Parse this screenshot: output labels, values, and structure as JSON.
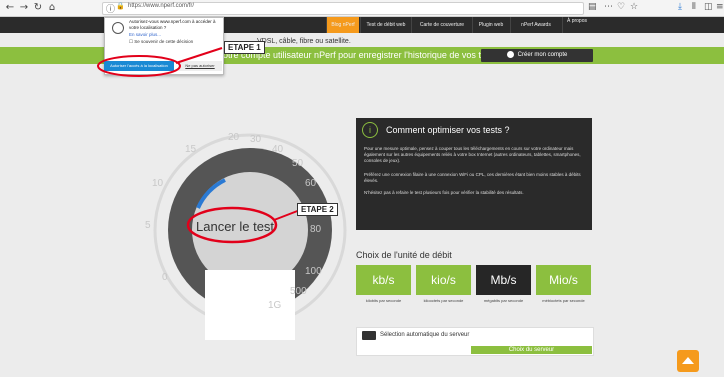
{
  "browser": {
    "url": "https://www.nperf.com/fr/",
    "icons": [
      "back-icon",
      "forward-icon",
      "reload-icon",
      "home-icon"
    ]
  },
  "nav": {
    "items": [
      "Blog nPerf",
      "Test de débit web",
      "Carte de couverture",
      "Plugin web",
      "nPerf Awards",
      "À propos"
    ]
  },
  "info_line": "VDSL, câble, fibre ou satellite.",
  "banner": {
    "text": "NOUVEAU ! Créez votre compte utilisateur nPerf pour enregistrer l'historique de vos tests",
    "button": "Créer mon compte"
  },
  "gauge": {
    "button": "Lancer le test",
    "ticks": [
      "0",
      "5",
      "10",
      "15",
      "20",
      "30",
      "40",
      "50",
      "60",
      "80",
      "100",
      "500",
      "1G"
    ]
  },
  "advice": {
    "title": "Comment optimiser vos tests ?",
    "p1": "Pour une mesure optimale, pensez à couper tous les téléchargements en cours sur votre ordinateur mais également sur les autres équipements reliés à votre box Internet (autres ordinateurs, tablettes, smartphones, consoles de jeux).",
    "p2": "Préférez une connexion filaire à une connexion WiFi ou CPL, ces dernières étant bien moins stables à débits élevés.",
    "p3": "N'hésitez pas à refaire le test plusieurs fois pour vérifier la stabilité des résultats."
  },
  "units": {
    "title": "Choix de l'unité de débit",
    "items": [
      {
        "label": "kb/s",
        "sub": "kilobits par seconde"
      },
      {
        "label": "kio/s",
        "sub": "kilooctets par seconde"
      },
      {
        "label": "Mb/s",
        "sub": "mégabits par seconde"
      },
      {
        "label": "Mio/s",
        "sub": "mébioctets par seconde"
      }
    ]
  },
  "server": {
    "label": "Sélection automatique du serveur",
    "button": "Choix du serveur"
  },
  "popup": {
    "text": "Autorisez-vous www.nperf.com à accéder à votre localisation ?",
    "more": "En savoir plus...",
    "remember": "Se souvenir de cette décision",
    "allow": "Autoriser l'accès à la localisation",
    "deny": "Ne pas autoriser"
  },
  "annotations": {
    "step1": "ETAPE 1",
    "step2": "ETAPE 2"
  },
  "colors": {
    "accent": "#8cbf3f",
    "nav_active": "#f59a1c",
    "annotation": "#e2001a"
  }
}
